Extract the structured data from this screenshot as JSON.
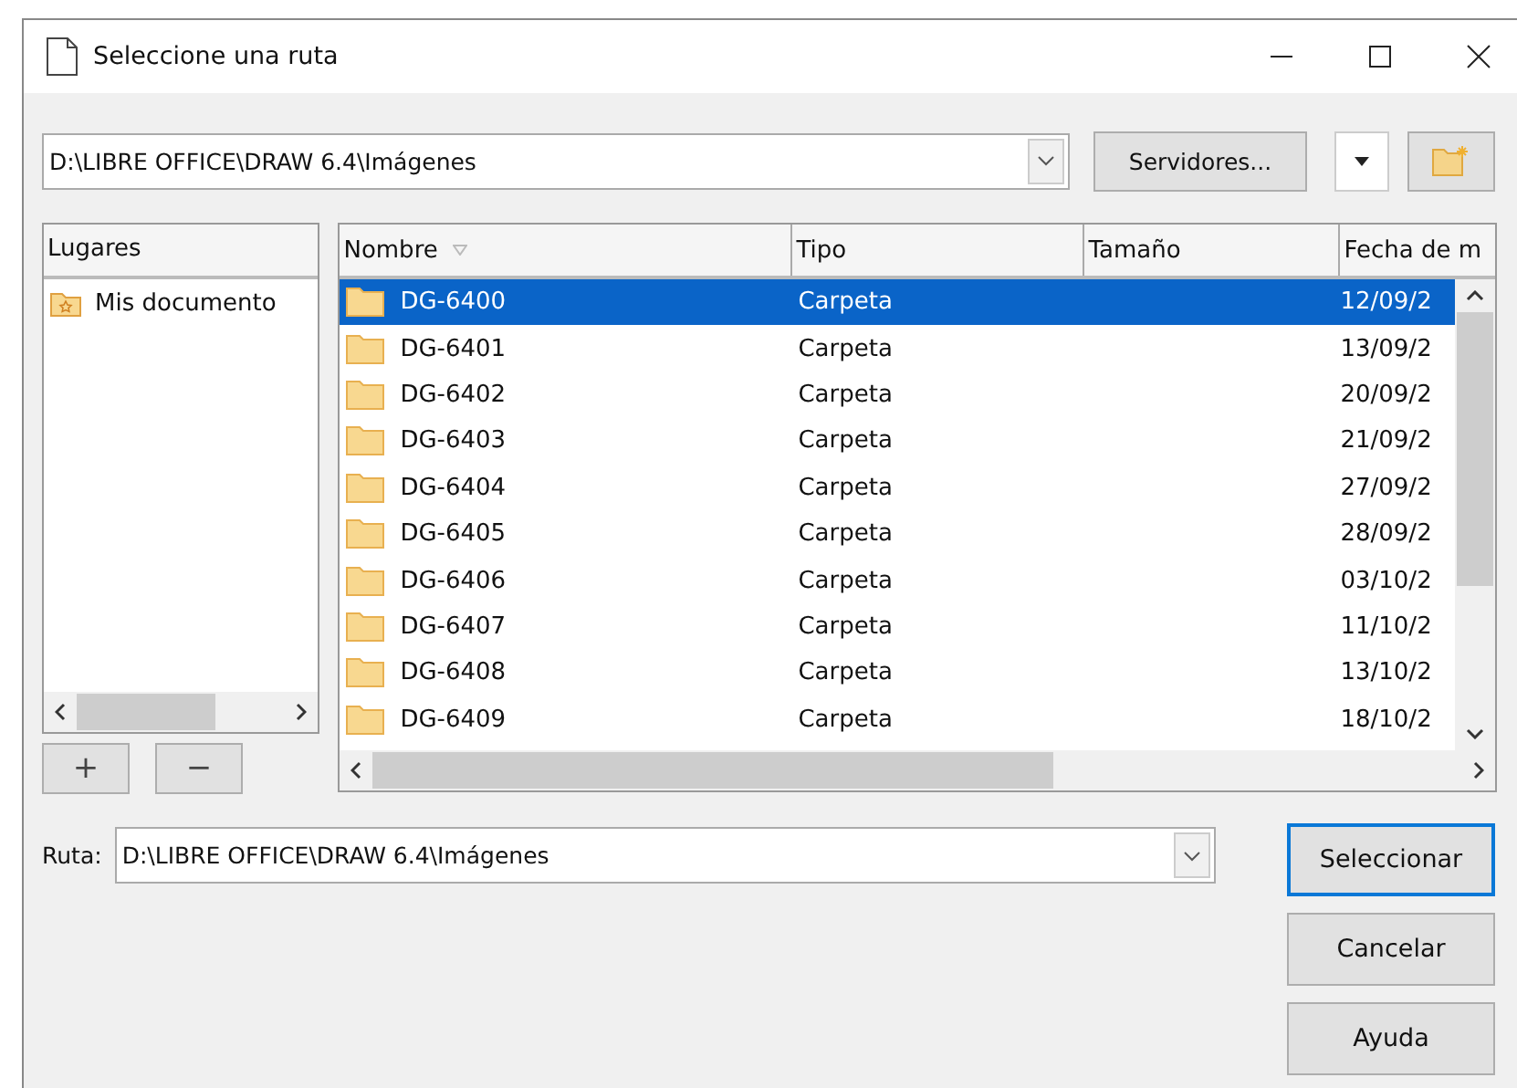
{
  "window": {
    "title": "Seleccione una ruta"
  },
  "path_combo": {
    "value": "D:\\LIBRE OFFICE\\DRAW 6.4\\Imágenes"
  },
  "servers_button": {
    "label": "Servidores..."
  },
  "places": {
    "heading": "Lugares",
    "items": [
      {
        "label": "Mis documento",
        "selected": false
      }
    ]
  },
  "table": {
    "columns": [
      "Nombre",
      "Tipo",
      "Tamaño",
      "Fecha de m"
    ],
    "rows": [
      {
        "name": "DG-6400",
        "type": "Carpeta",
        "date": "12/09/2",
        "selected": true
      },
      {
        "name": "DG-6401",
        "type": "Carpeta",
        "date": "13/09/2",
        "selected": false
      },
      {
        "name": "DG-6402",
        "type": "Carpeta",
        "date": "20/09/2",
        "selected": false
      },
      {
        "name": "DG-6403",
        "type": "Carpeta",
        "date": "21/09/2",
        "selected": false
      },
      {
        "name": "DG-6404",
        "type": "Carpeta",
        "date": "27/09/2",
        "selected": false
      },
      {
        "name": "DG-6405",
        "type": "Carpeta",
        "date": "28/09/2",
        "selected": false
      },
      {
        "name": "DG-6406",
        "type": "Carpeta",
        "date": "03/10/2",
        "selected": false
      },
      {
        "name": "DG-6407",
        "type": "Carpeta",
        "date": "11/10/2",
        "selected": false
      },
      {
        "name": "DG-6408",
        "type": "Carpeta",
        "date": "13/10/2",
        "selected": false
      },
      {
        "name": "DG-6409",
        "type": "Carpeta",
        "date": "18/10/2",
        "selected": false
      }
    ]
  },
  "place_buttons": [
    "+",
    "−"
  ],
  "path_field": {
    "label": "Ruta:",
    "value": "D:\\LIBRE OFFICE\\DRAW 6.4\\Imágenes"
  },
  "buttons": [
    {
      "label": "Seleccionar",
      "default": true
    },
    {
      "label": "Cancelar",
      "default": false
    },
    {
      "label": "Ayuda",
      "default": false
    }
  ]
}
